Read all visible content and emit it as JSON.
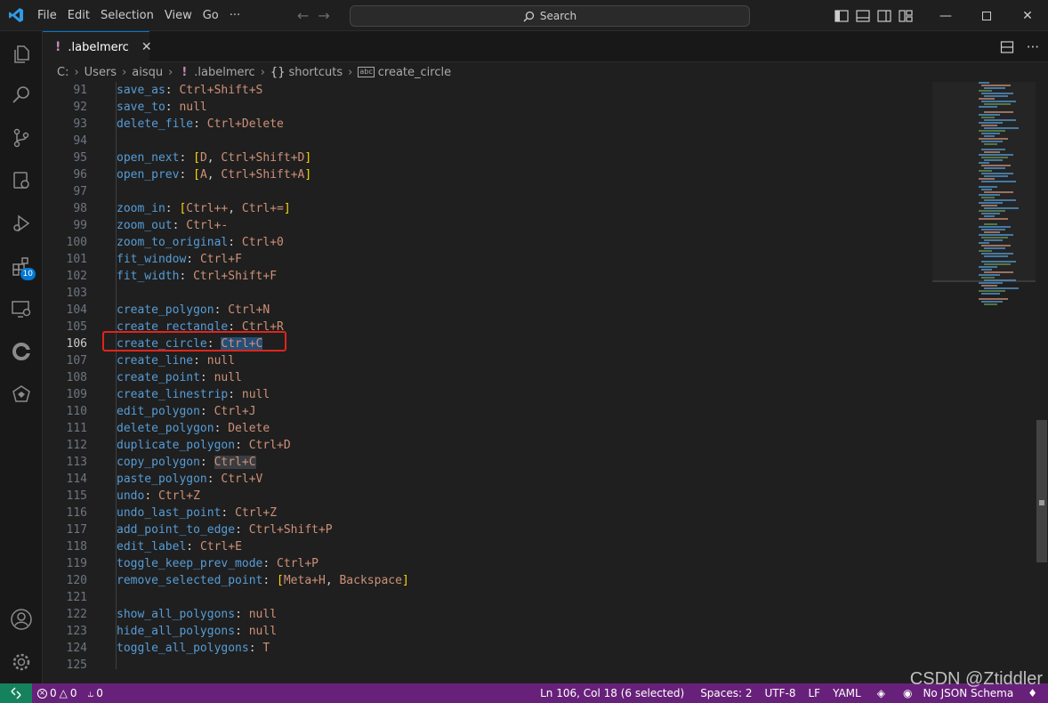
{
  "titlebar": {
    "menu": [
      {
        "label": "File"
      },
      {
        "label": "Edit"
      },
      {
        "label": "Selection"
      },
      {
        "label": "View"
      },
      {
        "label": "Go"
      },
      {
        "label": "···"
      }
    ],
    "search_label": "Search"
  },
  "activity": {
    "extensions_badge": "10"
  },
  "tab": {
    "filename": ".labelmerc"
  },
  "breadcrumb": {
    "drive": "C:",
    "users": "Users",
    "user": "aisqu",
    "file": ".labelmerc",
    "section_icon": "{}",
    "section": "shortcuts",
    "symbol_icon": "abc",
    "symbol": "create_circle"
  },
  "editor": {
    "active_line": 106,
    "lines": [
      {
        "n": "91",
        "k": "save_as",
        "v": "Ctrl+Shift+S"
      },
      {
        "n": "92",
        "k": "save_to",
        "v": "null"
      },
      {
        "n": "93",
        "k": "delete_file",
        "v": "Ctrl+Delete"
      },
      {
        "n": "94"
      },
      {
        "n": "95",
        "k": "open_next",
        "list": [
          "D",
          "Ctrl+Shift+D"
        ]
      },
      {
        "n": "96",
        "k": "open_prev",
        "list": [
          "A",
          "Ctrl+Shift+A"
        ]
      },
      {
        "n": "97"
      },
      {
        "n": "98",
        "k": "zoom_in",
        "list": [
          "Ctrl++",
          "Ctrl+="
        ]
      },
      {
        "n": "99",
        "k": "zoom_out",
        "v": "Ctrl+-"
      },
      {
        "n": "100",
        "k": "zoom_to_original",
        "v": "Ctrl+0"
      },
      {
        "n": "101",
        "k": "fit_window",
        "v": "Ctrl+F"
      },
      {
        "n": "102",
        "k": "fit_width",
        "v": "Ctrl+Shift+F"
      },
      {
        "n": "103"
      },
      {
        "n": "104",
        "k": "create_polygon",
        "v": "Ctrl+N"
      },
      {
        "n": "105",
        "k": "create_rectangle",
        "v": "Ctrl+R"
      },
      {
        "n": "106",
        "k": "create_circle",
        "v": "Ctrl+C",
        "selected": true
      },
      {
        "n": "107",
        "k": "create_line",
        "v": "null"
      },
      {
        "n": "108",
        "k": "create_point",
        "v": "null"
      },
      {
        "n": "109",
        "k": "create_linestrip",
        "v": "null"
      },
      {
        "n": "110",
        "k": "edit_polygon",
        "v": "Ctrl+J"
      },
      {
        "n": "111",
        "k": "delete_polygon",
        "v": "Delete"
      },
      {
        "n": "112",
        "k": "duplicate_polygon",
        "v": "Ctrl+D"
      },
      {
        "n": "113",
        "k": "copy_polygon",
        "v": "Ctrl+C",
        "highlight": true
      },
      {
        "n": "114",
        "k": "paste_polygon",
        "v": "Ctrl+V"
      },
      {
        "n": "115",
        "k": "undo",
        "v": "Ctrl+Z"
      },
      {
        "n": "116",
        "k": "undo_last_point",
        "v": "Ctrl+Z"
      },
      {
        "n": "117",
        "k": "add_point_to_edge",
        "v": "Ctrl+Shift+P"
      },
      {
        "n": "118",
        "k": "edit_label",
        "v": "Ctrl+E"
      },
      {
        "n": "119",
        "k": "toggle_keep_prev_mode",
        "v": "Ctrl+P"
      },
      {
        "n": "120",
        "k": "remove_selected_point",
        "list": [
          "Meta+H",
          "Backspace"
        ]
      },
      {
        "n": "121"
      },
      {
        "n": "122",
        "k": "show_all_polygons",
        "v": "null"
      },
      {
        "n": "123",
        "k": "hide_all_polygons",
        "v": "null"
      },
      {
        "n": "124",
        "k": "toggle_all_polygons",
        "v": "T"
      },
      {
        "n": "125"
      }
    ]
  },
  "statusbar": {
    "errors": "0",
    "warnings": "0",
    "ports": "0",
    "cursor": "Ln 106, Col 18 (6 selected)",
    "spaces": "Spaces: 2",
    "encoding": "UTF-8",
    "eol": "LF",
    "language": "YAML",
    "schema": "No JSON Schema"
  },
  "watermark": "CSDN @Ztiddler",
  "colors": {
    "statusbar_bg": "#68217a",
    "remote_bg": "#16825d",
    "key": "#569cd6",
    "value": "#ce9178",
    "bracket": "#ffd700",
    "selection": "#264f78",
    "callout": "#e0241c"
  }
}
